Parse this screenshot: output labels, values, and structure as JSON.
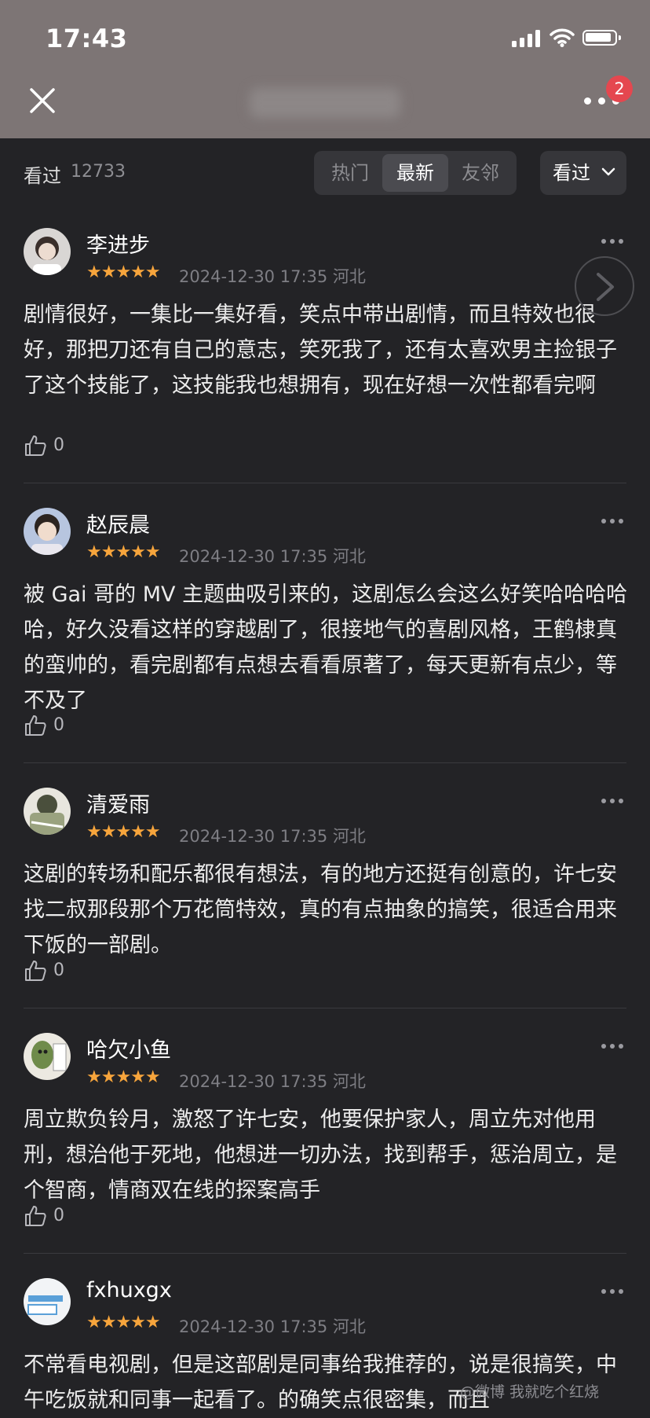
{
  "status_bar": {
    "time": "17:43"
  },
  "header": {
    "badge_count": "2"
  },
  "filter": {
    "seen_label": "看过",
    "seen_count": "12733",
    "tabs": [
      {
        "label": "热门",
        "active": false
      },
      {
        "label": "最新",
        "active": true
      },
      {
        "label": "友邻",
        "active": false
      }
    ],
    "dropdown_label": "看过"
  },
  "colors": {
    "star": "#f7a53c",
    "badge": "#e5474f",
    "background": "#232326"
  },
  "reviews": [
    {
      "username": "李进步",
      "stars": "★★★★★",
      "rating": 5,
      "meta": "2024-12-30 17:35 河北",
      "text": "剧情很好，一集比一集好看，笑点中带出剧情，而且特效也很好，那把刀还有自己的意志，笑死我了，还有太喜欢男主捡银子了这个技能了，这技能我也想拥有，现在好想一次性都看完啊",
      "likes": "0"
    },
    {
      "username": "赵辰晨",
      "stars": "★★★★★",
      "rating": 5,
      "meta": "2024-12-30 17:35 河北",
      "text": "被 Gai 哥的 MV 主题曲吸引来的，这剧怎么会这么好笑哈哈哈哈哈，好久没看这样的穿越剧了，很接地气的喜剧风格，王鹤棣真的蛮帅的，看完剧都有点想去看看原著了，每天更新有点少，等不及了",
      "likes": "0"
    },
    {
      "username": "清爱雨",
      "stars": "★★★★★",
      "rating": 5,
      "meta": "2024-12-30 17:35 河北",
      "text": "这剧的转场和配乐都很有想法，有的地方还挺有创意的，许七安找二叔那段那个万花筒特效，真的有点抽象的搞笑，很适合用来下饭的一部剧。",
      "likes": "0"
    },
    {
      "username": "哈欠小鱼",
      "stars": "★★★★★",
      "rating": 5,
      "meta": "2024-12-30 17:35 河北",
      "text": "周立欺负铃月，激怒了许七安，他要保护家人，周立先对他用刑，想治他于死地，他想进一切办法，找到帮手，惩治周立，是个智商，情商双在线的探案高手",
      "likes": "0"
    },
    {
      "username": "fxhuxgx",
      "stars": "★★★★★",
      "rating": 5,
      "meta": "2024-12-30 17:35 河北",
      "text": "不常看电视剧，但是这部剧是同事给我推荐的，说是很搞笑，中午吃饭就和同事一起看了。的确笑点很密集，而且",
      "likes": ""
    }
  ],
  "icons": [
    "close-icon",
    "more-icon",
    "chevron-down-icon",
    "chevron-right-icon",
    "thumbs-up-icon",
    "signal-icon",
    "wifi-icon",
    "battery-icon"
  ],
  "watermark": "@微博 我就吃个红烧"
}
